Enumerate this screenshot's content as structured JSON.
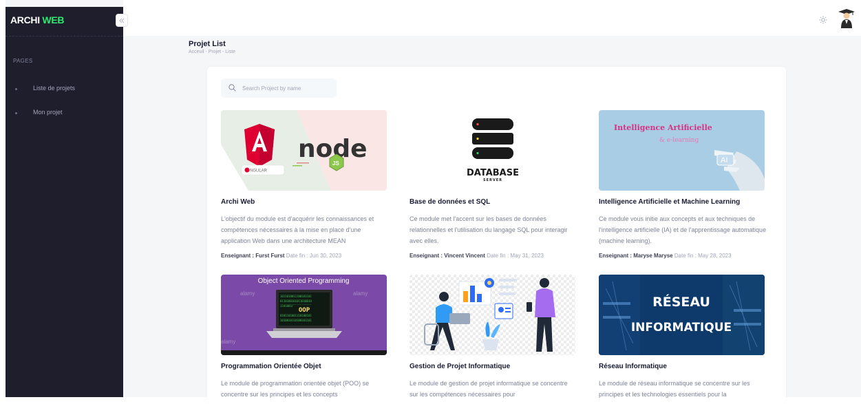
{
  "brand": {
    "part1": "ARCHI ",
    "part2": "WEB"
  },
  "sidebar": {
    "heading": "PAGES",
    "items": [
      {
        "label": "Liste de projets"
      },
      {
        "label": "Mon projet"
      }
    ],
    "toggle_icon": "double-chevron-left-icon"
  },
  "header": {
    "theme_icon": "sun-icon",
    "avatar_icon": "graduate-avatar-icon"
  },
  "page": {
    "title": "Projet List",
    "breadcrumb": "Acceuil - Projet - Liste"
  },
  "search": {
    "placeholder": "Search Project by name",
    "value": ""
  },
  "colors": {
    "sidebar_bg": "#1e1e2d",
    "brand_accent": "#2ee86f",
    "page_bg": "#f5f6f8"
  },
  "projects": [
    {
      "title": "Archi Web",
      "description": "L'objectif du module est d'acquérir les connaissances et compétences nécessaires à la mise en place d'une application Web dans une architecture MEAN",
      "teacher": "Enseignant : Furst Furst",
      "date": "Date fin : Jun 30, 2023",
      "thumb": {
        "text1": "node",
        "text2": "NGULAR",
        "text3": "JS"
      }
    },
    {
      "title": "Base de données et SQL",
      "description": "Ce module met l'accent sur les bases de données relationnelles et l'utilisation du langage SQL pour interagir avec elles.",
      "teacher": "Enseignant : Vincent Vincent",
      "date": "Date fin : May 31, 2023",
      "thumb": {
        "text1": "DATABASE",
        "text2": "SERVER"
      }
    },
    {
      "title": "Intelligence Artificielle et Machine Learning",
      "description": "Ce module vous initie aux concepts et aux techniques de l'intelligence artificielle (IA) et de l'apprentissage automatique (machine learning).",
      "teacher": "Enseignant : Maryse Maryse",
      "date": "Date fin : May 28, 2023",
      "thumb": {
        "text1": "Intelligence Artificielle",
        "text2": "& e-learning",
        "text3": "AI"
      }
    },
    {
      "title": "Programmation Orientée Objet",
      "description": "Le module de programmation orientée objet (POO) se concentre sur les principes et les concepts",
      "thumb": {
        "text1": "Object Oriented Programming",
        "text2": "OOP",
        "text3": "alamy"
      }
    },
    {
      "title": "Gestion de Projet Informatique",
      "description": "Le module de gestion de projet informatique se concentre sur les compétences nécessaires pour",
      "thumb": {}
    },
    {
      "title": "Réseau Informatique",
      "description": "Le module de réseau informatique se concentre sur les principes et les technologies essentiels pour la",
      "thumb": {
        "text1": "RÉSEAU",
        "text2": "INFORMATIQUE"
      }
    }
  ]
}
